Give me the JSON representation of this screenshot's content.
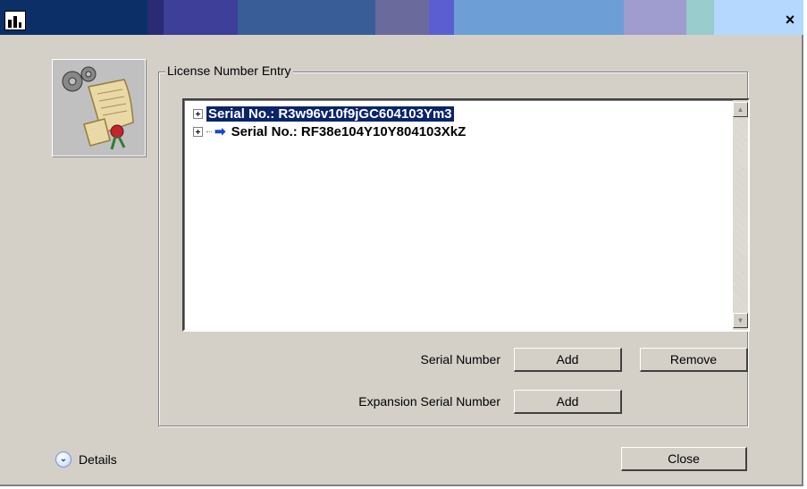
{
  "window": {
    "close_label": "×",
    "titlebar_colors": [
      "#0c2f67",
      "#2a2a75",
      "#3e3f98",
      "#395e97",
      "#4b6fa6",
      "#6a6a9d",
      "#5a5ed0",
      "#5c95d4",
      "#6d9fd6",
      "#9f9cd0",
      "#9fb1db",
      "#99cccc",
      "#a3c9ee",
      "#b4d8ff"
    ]
  },
  "group": {
    "title": "License Number Entry"
  },
  "serials": [
    {
      "label": "Serial No.: R3w96v10f9jGC604103Ym3",
      "selected": true
    },
    {
      "label": "Serial No.: RF38e104Y10Y804103XkZ",
      "selected": false
    }
  ],
  "rows": {
    "serial_number": {
      "label": "Serial Number",
      "add": "Add",
      "remove": "Remove"
    },
    "expansion": {
      "label": "Expansion Serial Number",
      "add": "Add"
    }
  },
  "footer": {
    "details": "Details",
    "close": "Close"
  },
  "icons": {
    "app": "bar-chart-icon",
    "side": "license-certificate-gears-icon",
    "arrow": "arrow-right-icon",
    "details": "chevron-down-circle-icon"
  }
}
